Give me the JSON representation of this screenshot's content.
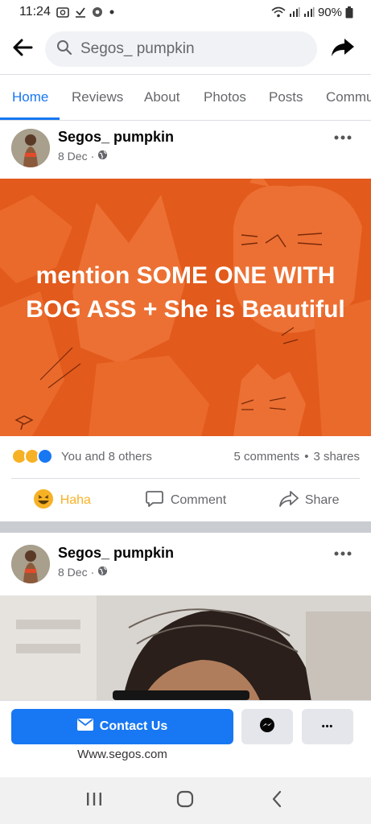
{
  "status_bar": {
    "time": "11:24",
    "battery": "90%",
    "icons": [
      "photo-notification-icon",
      "download-done-icon",
      "chrome-icon",
      "dot-icon",
      "wifi-icon",
      "signal-icon",
      "signal-icon",
      "battery-icon"
    ]
  },
  "header": {
    "search_value": "Segos_ pumpkin",
    "back_icon": "arrow-left-icon",
    "share_icon": "share-arrow-icon"
  },
  "tabs": [
    {
      "label": "Home",
      "active": true
    },
    {
      "label": "Reviews",
      "active": false
    },
    {
      "label": "About",
      "active": false
    },
    {
      "label": "Photos",
      "active": false
    },
    {
      "label": "Posts",
      "active": false
    },
    {
      "label": "Commu",
      "active": false
    }
  ],
  "posts": [
    {
      "page_name": "Segos_ pumpkin",
      "date": "8 Dec",
      "separator": "·",
      "image_text": "mention SOME ONE WITH BOG ASS + She is Beautiful",
      "reactions_summary": "You and 8 others",
      "comments": "5 comments",
      "shares": "3 shares",
      "dot": "•",
      "actions": {
        "react": "Haha",
        "comment": "Comment",
        "share": "Share"
      }
    },
    {
      "page_name": "Segos_ pumpkin",
      "date": "8 Dec",
      "separator": "·"
    }
  ],
  "bottom": {
    "contact_label": "Contact Us",
    "more_label": "•••",
    "website": "Www.segos.com"
  },
  "colors": {
    "accent": "#1877f2",
    "post_bg": "#e25a1c",
    "haha": "#f7b125"
  }
}
